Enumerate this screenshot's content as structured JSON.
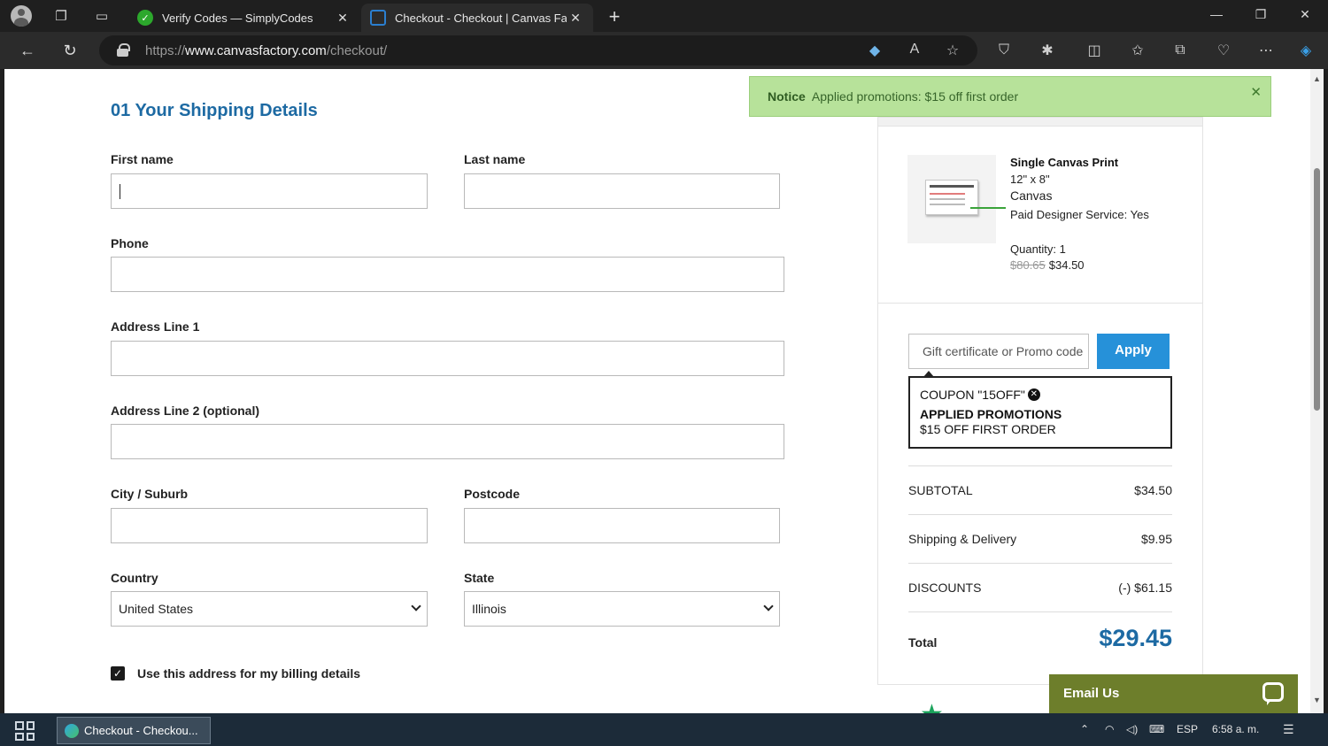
{
  "browser": {
    "tabs": [
      {
        "title": "Verify Codes — SimplyCodes",
        "favicon": "simplycodes-icon"
      },
      {
        "title": "Checkout - Checkout | Canvas Fa",
        "favicon": "canvasfactory-icon"
      }
    ],
    "url_prefix": "https://",
    "url_host": "www.canvasfactory.com",
    "url_path": "/checkout/"
  },
  "notice": {
    "label": "Notice",
    "text": "Applied promotions: $15 off first order"
  },
  "shipping": {
    "title": "01  Your Shipping Details",
    "first_name_label": "First name",
    "last_name_label": "Last name",
    "phone_label": "Phone",
    "address1_label": "Address Line 1",
    "address2_label": "Address Line 2 (optional)",
    "city_label": "City / Suburb",
    "postcode_label": "Postcode",
    "country_label": "Country",
    "country_value": "United States",
    "state_label": "State",
    "state_value": "Illinois",
    "billing_label": "Use this address for my billing details",
    "billing_checked": true
  },
  "summary": {
    "product_name": "Single Canvas Print",
    "size": "12\" x 8\"",
    "material": "Canvas",
    "designer_service": "Paid Designer Service:  Yes",
    "quantity": "Quantity: 1",
    "old_price": "$80.65",
    "price": "$34.50",
    "promo_placeholder": "Gift certificate or Promo code",
    "apply_label": "Apply",
    "coupon_code": "COUPON \"15OFF\"",
    "applied_promotions_label": "APPLIED PROMOTIONS",
    "applied_promotion_desc": "$15 OFF FIRST ORDER",
    "subtotal_label": "SUBTOTAL",
    "subtotal_value": "$34.50",
    "shipping_label": "Shipping & Delivery",
    "shipping_value": "$9.95",
    "discounts_label": "DISCOUNTS",
    "discounts_value": "(-) $61.15",
    "total_label": "Total",
    "total_value": "$29.45"
  },
  "email_us": {
    "label": "Email Us"
  },
  "taskbar": {
    "task_label": "Checkout - Checkou...",
    "language": "ESP",
    "time": "6:58 a. m."
  },
  "colors": {
    "accent_blue": "#1d6aa3",
    "apply_button": "#2691d9",
    "notice_bg": "#b7e29a",
    "email_us_bg": "#6d7e2b"
  }
}
